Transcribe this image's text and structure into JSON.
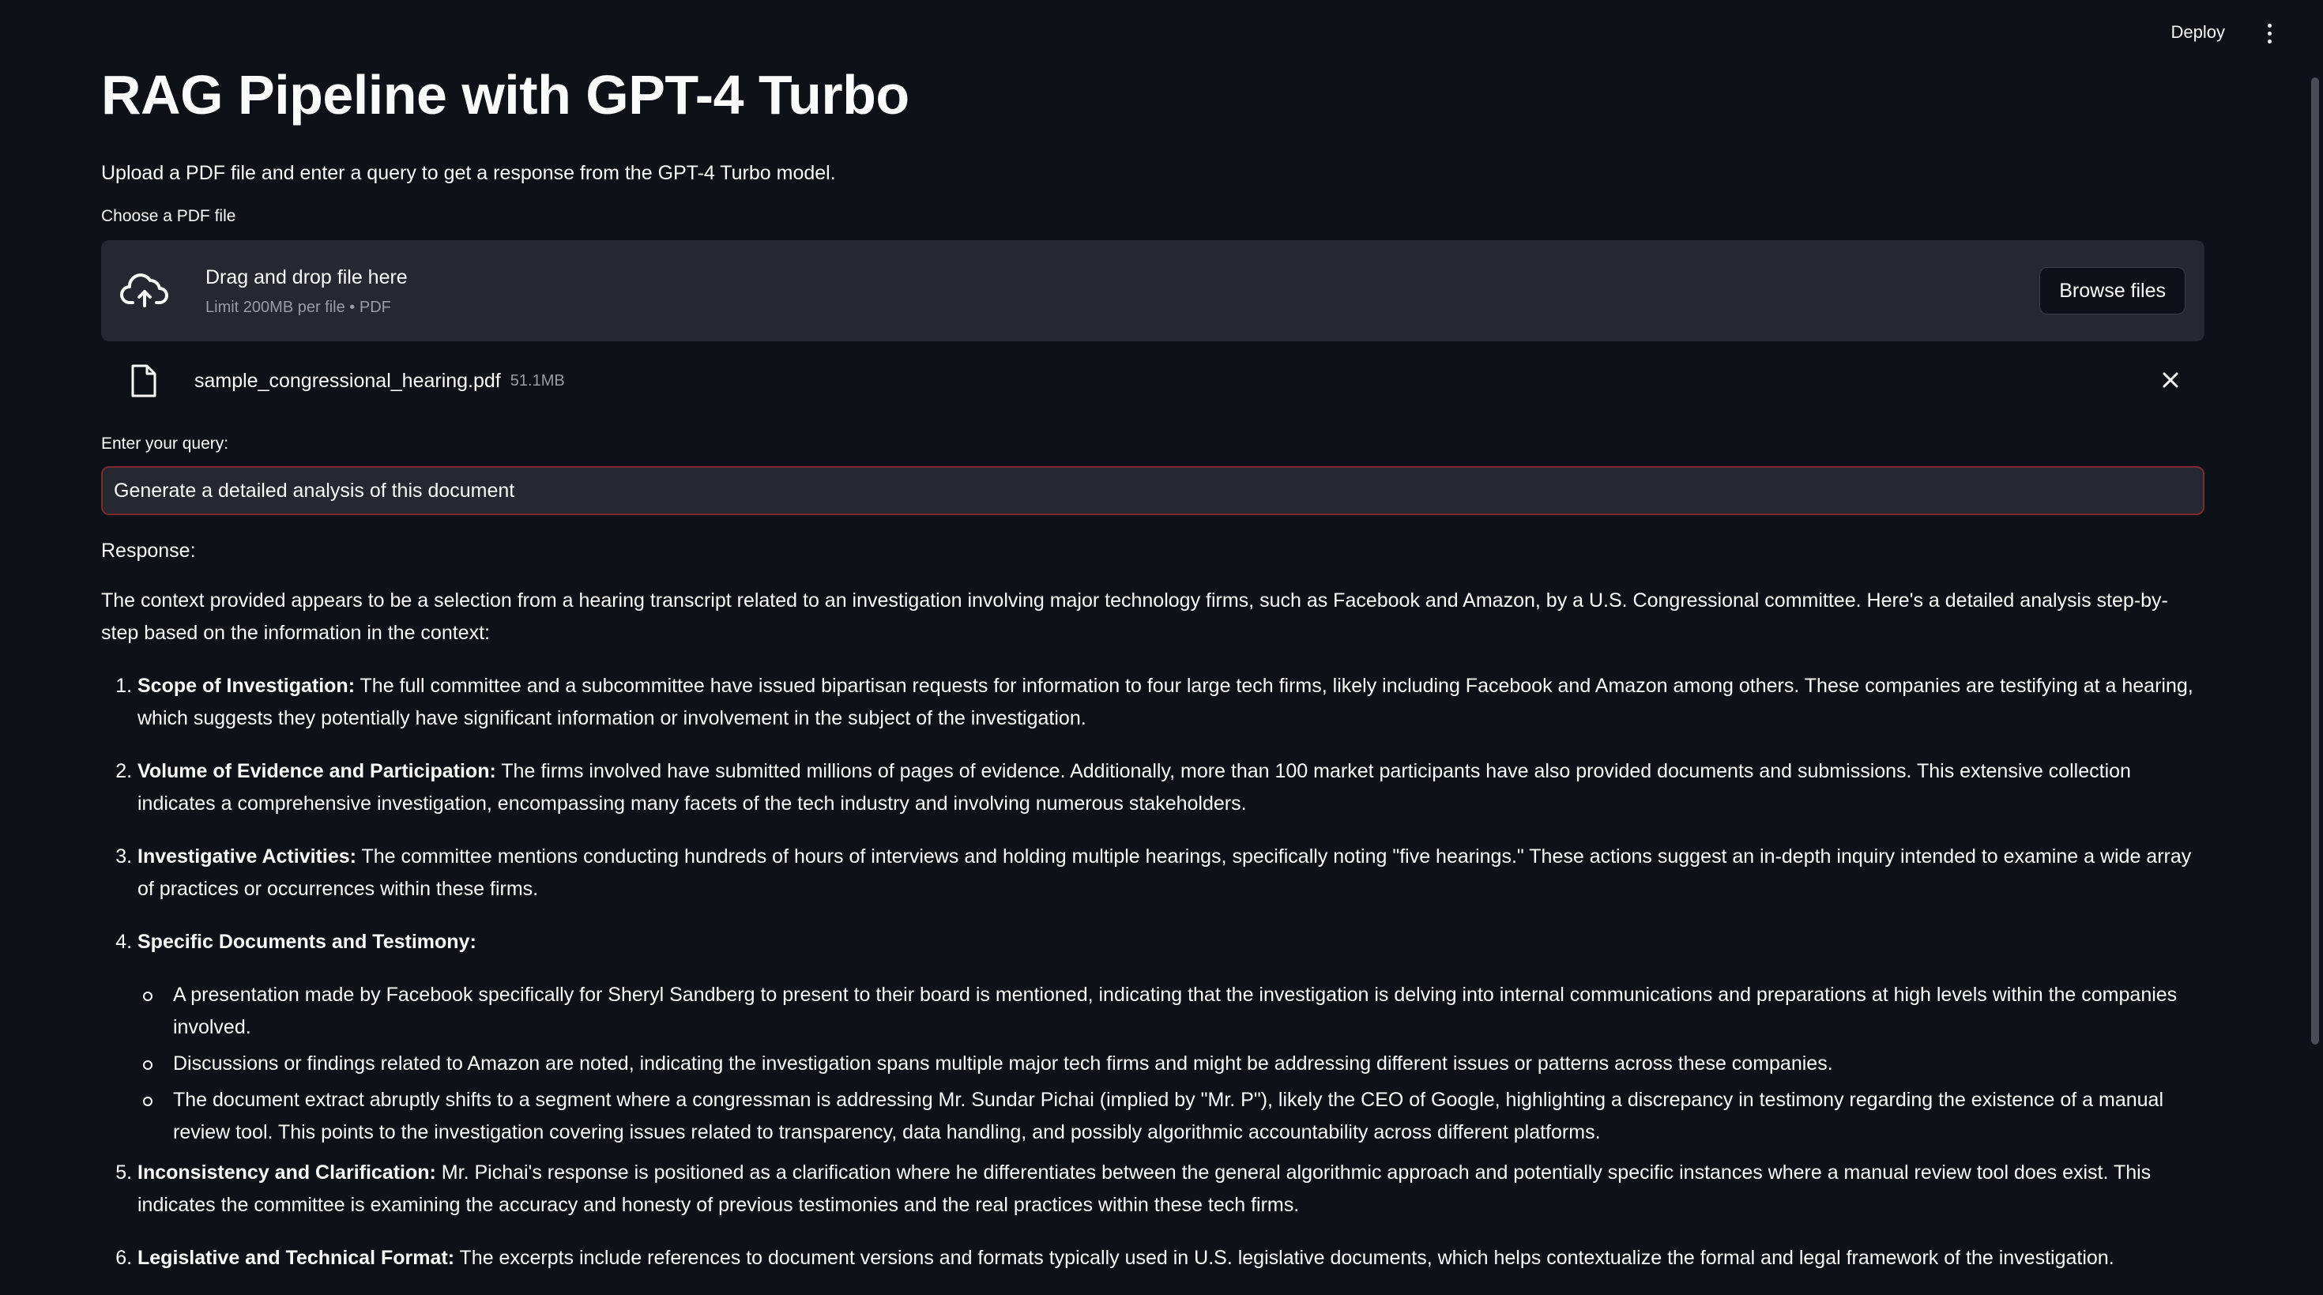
{
  "header": {
    "deploy_label": "Deploy",
    "menu_icon": "vertical-ellipsis-icon"
  },
  "page": {
    "title": "RAG Pipeline with GPT-4 Turbo",
    "subtitle": "Upload a PDF file and enter a query to get a response from the GPT-4 Turbo model."
  },
  "uploader": {
    "label": "Choose a PDF file",
    "drop_title": "Drag and drop file here",
    "drop_limit": "Limit 200MB per file • PDF",
    "browse_label": "Browse files",
    "icon": "cloud-upload-icon"
  },
  "uploaded_file": {
    "name": "sample_congressional_hearing.pdf",
    "size": "51.1MB",
    "icon": "file-icon",
    "remove_icon": "close-icon"
  },
  "query": {
    "label": "Enter your query:",
    "value": "Generate a detailed analysis of this document"
  },
  "response": {
    "label": "Response:",
    "intro": "The context provided appears to be a selection from a hearing transcript related to an investigation involving major technology firms, such as Facebook and Amazon, by a U.S. Congressional committee. Here's a detailed analysis step-by-step based on the information in the context:",
    "items": [
      {
        "title": "Scope of Investigation:",
        "text": " The full committee and a subcommittee have issued bipartisan requests for information to four large tech firms, likely including Facebook and Amazon among others. These companies are testifying at a hearing, which suggests they potentially have significant information or involvement in the subject of the investigation."
      },
      {
        "title": "Volume of Evidence and Participation:",
        "text": " The firms involved have submitted millions of pages of evidence. Additionally, more than 100 market participants have also provided documents and submissions. This extensive collection indicates a comprehensive investigation, encompassing many facets of the tech industry and involving numerous stakeholders."
      },
      {
        "title": "Investigative Activities:",
        "text": " The committee mentions conducting hundreds of hours of interviews and holding multiple hearings, specifically noting \"five hearings.\" These actions suggest an in-depth inquiry intended to examine a wide array of practices or occurrences within these firms."
      },
      {
        "title": "Specific Documents and Testimony:",
        "text": "",
        "sub": [
          "A presentation made by Facebook specifically for Sheryl Sandberg to present to their board is mentioned, indicating that the investigation is delving into internal communications and preparations at high levels within the companies involved.",
          "Discussions or findings related to Amazon are noted, indicating the investigation spans multiple major tech firms and might be addressing different issues or patterns across these companies.",
          "The document extract abruptly shifts to a segment where a congressman is addressing Mr. Sundar Pichai (implied by \"Mr. P\"), likely the CEO of Google, highlighting a discrepancy in testimony regarding the existence of a manual review tool. This points to the investigation covering issues related to transparency, data handling, and possibly algorithmic accountability across different platforms."
        ]
      },
      {
        "title": "Inconsistency and Clarification:",
        "text": " Mr. Pichai's response is positioned as a clarification where he differentiates between the general algorithmic approach and potentially specific instances where a manual review tool does exist. This indicates the committee is examining the accuracy and honesty of previous testimonies and the real practices within these tech firms."
      },
      {
        "title": "Legislative and Technical Format:",
        "text": " The excerpts include references to document versions and formats typically used in U.S. legislative documents, which helps contextualize the formal and legal framework of the investigation."
      }
    ]
  }
}
